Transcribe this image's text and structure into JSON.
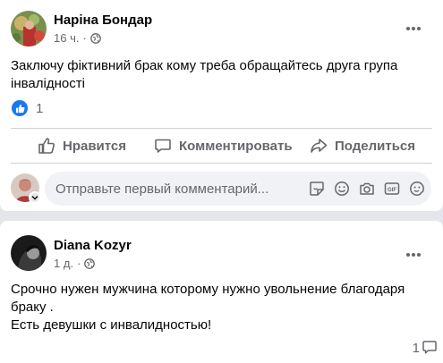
{
  "post1": {
    "author": "Наріна Бондар",
    "time": "16 ч.",
    "separator": "·",
    "text": "Заключу фіктивний брак кому треба обращайтесь друга група інвалідності",
    "reaction_count": "1",
    "actions": {
      "like": "Нравится",
      "comment": "Комментировать",
      "share": "Поделиться"
    },
    "comment_placeholder": "Отправьте первый комментарий...",
    "comment_icons": [
      "sticker-icon",
      "emoji-icon",
      "camera-icon",
      "gif-icon",
      "avatar-sticker-icon"
    ]
  },
  "post2": {
    "author": "Diana Kozyr",
    "time": "1 д.",
    "separator": "·",
    "text_line1": "Срочно нужен мужчина которому нужно увольнение благодаря",
    "text_line2": "браку .",
    "text_line3": "Есть девушки с инвалидностью!",
    "comment_count": "1"
  },
  "colors": {
    "accent": "#1877f2",
    "secondary_text": "#65676b",
    "primary_text": "#050505",
    "background": "#e4e6eb",
    "card": "#ffffff",
    "input_bg": "#f0f2f5"
  }
}
